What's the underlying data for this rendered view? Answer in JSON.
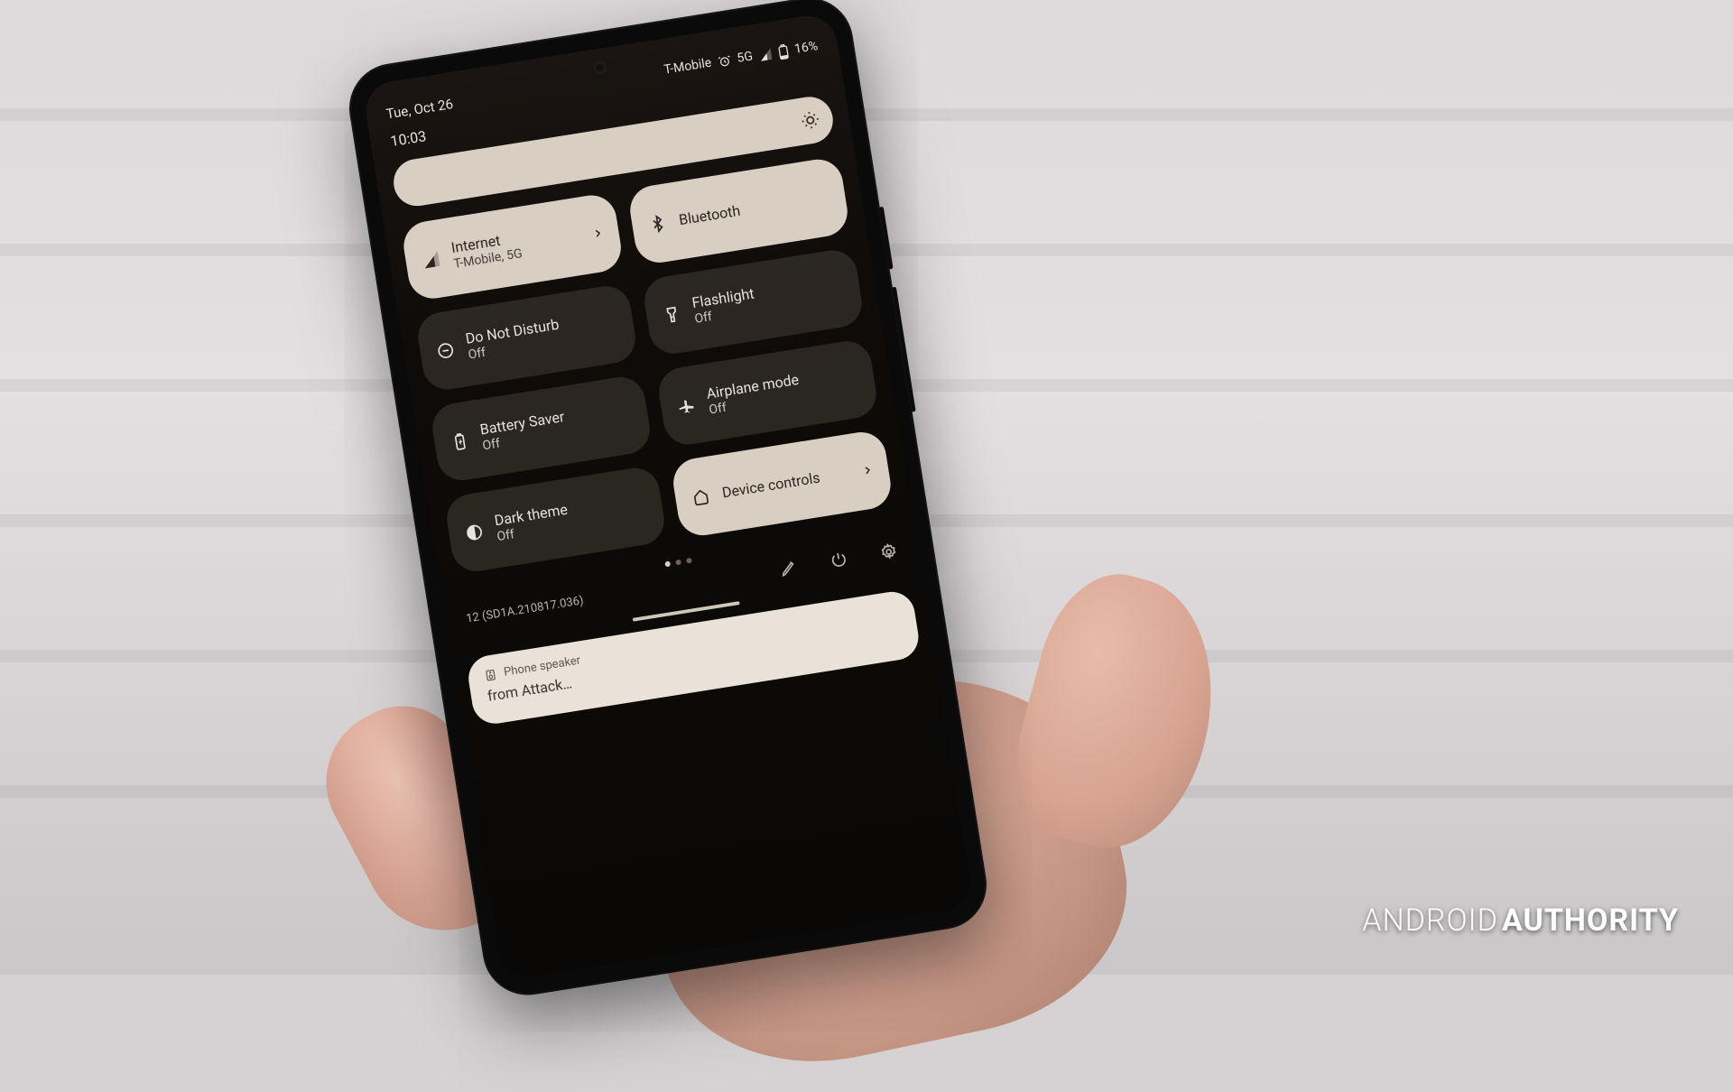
{
  "status": {
    "date": "Tue, Oct 26",
    "carrier": "T-Mobile",
    "network": "5G",
    "battery": "16%",
    "time": "10:03"
  },
  "tiles": [
    {
      "id": "internet",
      "title": "Internet",
      "sub": "T-Mobile, 5G",
      "on": true,
      "chevron": true,
      "icon": "signal"
    },
    {
      "id": "bluetooth",
      "title": "Bluetooth",
      "sub": "",
      "on": true,
      "chevron": false,
      "icon": "bluetooth"
    },
    {
      "id": "dnd",
      "title": "Do Not Disturb",
      "sub": "Off",
      "on": false,
      "chevron": false,
      "icon": "dnd"
    },
    {
      "id": "flashlight",
      "title": "Flashlight",
      "sub": "Off",
      "on": false,
      "chevron": false,
      "icon": "flashlight"
    },
    {
      "id": "battery-saver",
      "title": "Battery Saver",
      "sub": "Off",
      "on": false,
      "chevron": false,
      "icon": "battery"
    },
    {
      "id": "airplane",
      "title": "Airplane mode",
      "sub": "Off",
      "on": false,
      "chevron": false,
      "icon": "airplane"
    },
    {
      "id": "dark-theme",
      "title": "Dark theme",
      "sub": "Off",
      "on": false,
      "chevron": false,
      "icon": "darktheme"
    },
    {
      "id": "device-controls",
      "title": "Device controls",
      "sub": "",
      "on": true,
      "chevron": true,
      "icon": "home"
    }
  ],
  "footer": {
    "build": "12 (SD1A.210817.036)"
  },
  "notification": {
    "source": "Phone speaker",
    "title": "from Attack…"
  },
  "watermark": {
    "a": "ANDROID",
    "b": "AUTHORITY"
  }
}
